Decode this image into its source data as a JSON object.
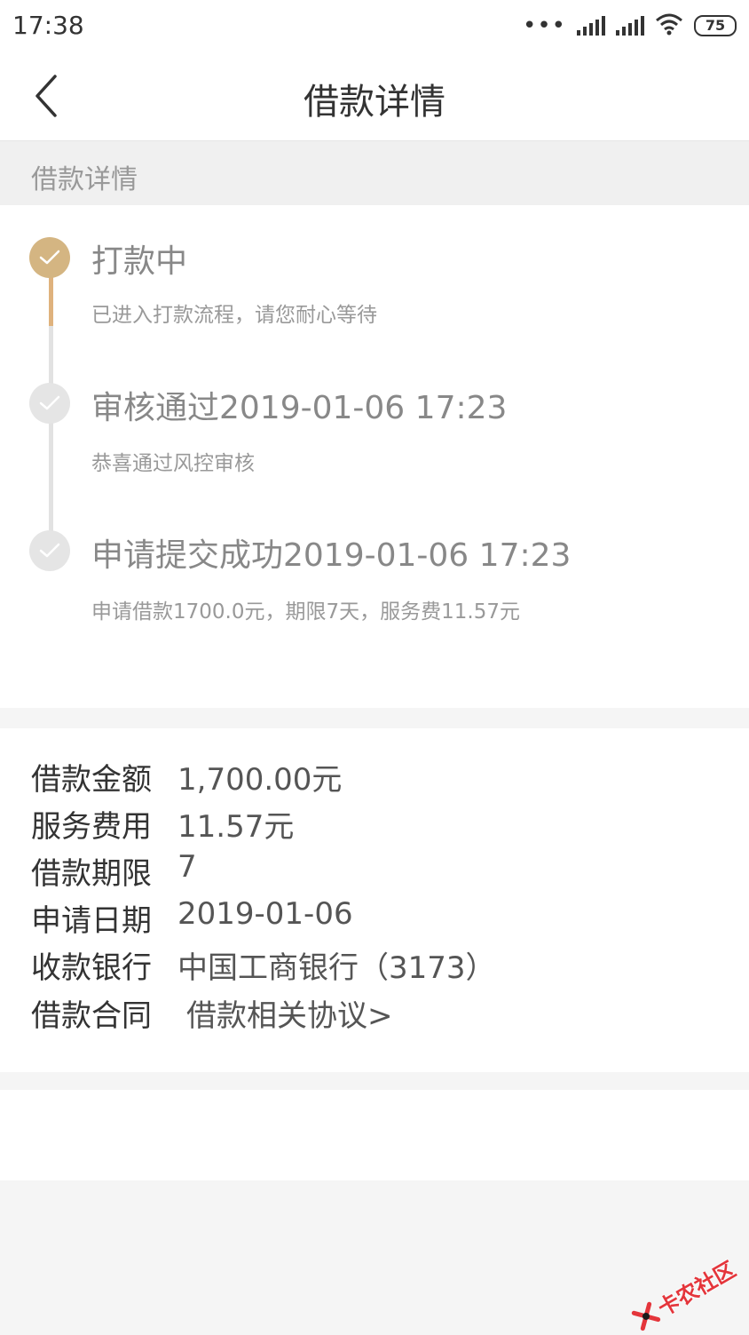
{
  "status_bar": {
    "time": "17:38",
    "battery": "75",
    "icons": [
      "more-dots-icon",
      "signal-icon",
      "signal-icon",
      "wifi-icon",
      "battery-icon"
    ]
  },
  "header": {
    "title": "借款详情",
    "back_icon": "chevron-left-icon"
  },
  "section_label": "借款详情",
  "timeline": {
    "steps": [
      {
        "title": "打款中",
        "desc": "已进入打款流程，请您耐心等待",
        "status": "active"
      },
      {
        "title": "审核通过2019-01-06 17:23",
        "desc": "恭喜通过风控审核",
        "status": "done"
      },
      {
        "title": "申请提交成功2019-01-06 17:23",
        "desc": "申请借款1700.0元，期限7天，服务费11.57元",
        "status": "done"
      }
    ],
    "active_color": "#d4b582",
    "inactive_color": "#e5e5e5"
  },
  "loan_info": {
    "amount_label": "借款金额",
    "amount_value": "1,700.00元",
    "fee_label": "服务费用",
    "fee_value": "11.57元",
    "term_label": "借款期限",
    "term_value": "7",
    "date_label": "申请日期",
    "date_value": "2019-01-06",
    "bank_label": "收款银行",
    "bank_value": "中国工商银行（3173）",
    "contract_label": "借款合同",
    "contract_link": "借款相关协议>"
  },
  "watermark": {
    "text": "卡农社区",
    "icon": "logo-icon"
  }
}
